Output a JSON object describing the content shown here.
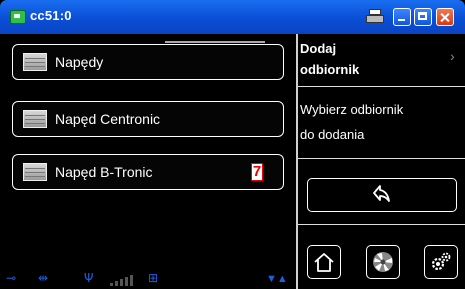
{
  "window": {
    "title": "cc51:0"
  },
  "left_panel": {
    "items": [
      {
        "label": "Napędy"
      },
      {
        "label": "Napęd Centronic"
      },
      {
        "label": "Napęd B-Tronic",
        "badge": "7"
      }
    ]
  },
  "right_panel": {
    "title_line1": "Dodaj",
    "title_line2": "odbiornik",
    "desc_line1": "Wybierz odbiornik",
    "desc_line2": "do dodania"
  },
  "icons": {
    "app": "app-icon",
    "printer": "printer-icon",
    "back": "undo-arrow-icon",
    "home": "home-icon",
    "fan": "fan-icon",
    "settings": "gears-icon"
  },
  "colors": {
    "titlebar": "#0a4fd6",
    "background": "#000000",
    "status_icons": "#1d5fe0",
    "badge": "#e00000"
  }
}
